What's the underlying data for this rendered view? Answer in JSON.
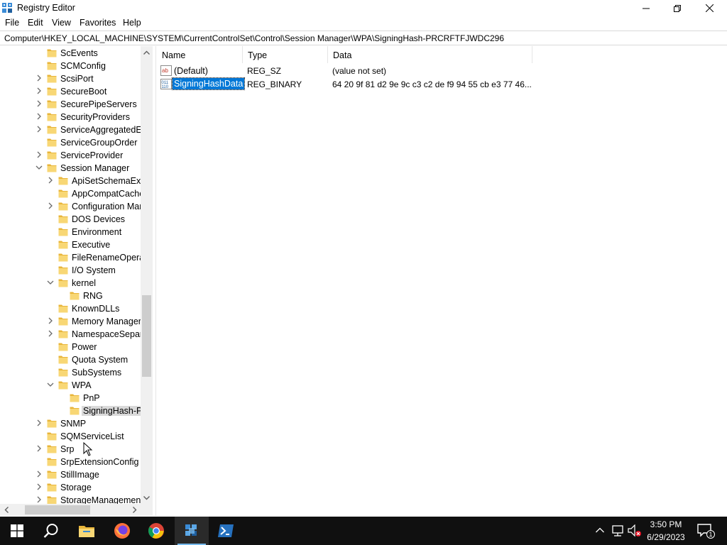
{
  "window": {
    "title": "Registry Editor",
    "controls": {
      "minimize": "minimize",
      "maximize": "restore",
      "close": "close"
    }
  },
  "menu": {
    "items": [
      "File",
      "Edit",
      "View",
      "Favorites",
      "Help"
    ]
  },
  "address": {
    "path": "Computer\\HKEY_LOCAL_MACHINE\\SYSTEM\\CurrentControlSet\\Control\\Session Manager\\WPA\\SigningHash-PRCRFTFJWDC296"
  },
  "tree": {
    "items": [
      {
        "label": "ScEvents",
        "level": 0,
        "expander": "none"
      },
      {
        "label": "SCMConfig",
        "level": 0,
        "expander": "none"
      },
      {
        "label": "ScsiPort",
        "level": 0,
        "expander": "collapsed"
      },
      {
        "label": "SecureBoot",
        "level": 0,
        "expander": "collapsed"
      },
      {
        "label": "SecurePipeServers",
        "level": 0,
        "expander": "collapsed"
      },
      {
        "label": "SecurityProviders",
        "level": 0,
        "expander": "collapsed"
      },
      {
        "label": "ServiceAggregatedEv",
        "level": 0,
        "expander": "collapsed"
      },
      {
        "label": "ServiceGroupOrder",
        "level": 0,
        "expander": "none"
      },
      {
        "label": "ServiceProvider",
        "level": 0,
        "expander": "collapsed"
      },
      {
        "label": "Session Manager",
        "level": 0,
        "expander": "expanded"
      },
      {
        "label": "ApiSetSchemaExte",
        "level": 1,
        "expander": "collapsed"
      },
      {
        "label": "AppCompatCache",
        "level": 1,
        "expander": "none"
      },
      {
        "label": "Configuration Mar",
        "level": 1,
        "expander": "collapsed"
      },
      {
        "label": "DOS Devices",
        "level": 1,
        "expander": "none"
      },
      {
        "label": "Environment",
        "level": 1,
        "expander": "none"
      },
      {
        "label": "Executive",
        "level": 1,
        "expander": "none"
      },
      {
        "label": "FileRenameOperat",
        "level": 1,
        "expander": "none"
      },
      {
        "label": "I/O System",
        "level": 1,
        "expander": "none"
      },
      {
        "label": "kernel",
        "level": 1,
        "expander": "expanded"
      },
      {
        "label": "RNG",
        "level": 2,
        "expander": "none"
      },
      {
        "label": "KnownDLLs",
        "level": 1,
        "expander": "none"
      },
      {
        "label": "Memory Manager",
        "level": 1,
        "expander": "collapsed"
      },
      {
        "label": "NamespaceSepara",
        "level": 1,
        "expander": "collapsed"
      },
      {
        "label": "Power",
        "level": 1,
        "expander": "none"
      },
      {
        "label": "Quota System",
        "level": 1,
        "expander": "none"
      },
      {
        "label": "SubSystems",
        "level": 1,
        "expander": "none"
      },
      {
        "label": "WPA",
        "level": 1,
        "expander": "expanded"
      },
      {
        "label": "PnP",
        "level": 2,
        "expander": "none"
      },
      {
        "label": "SigningHash-P",
        "level": 2,
        "expander": "none",
        "selected": true
      },
      {
        "label": "SNMP",
        "level": 0,
        "expander": "collapsed"
      },
      {
        "label": "SQMServiceList",
        "level": 0,
        "expander": "none"
      },
      {
        "label": "Srp",
        "level": 0,
        "expander": "collapsed"
      },
      {
        "label": "SrpExtensionConfig",
        "level": 0,
        "expander": "none"
      },
      {
        "label": "StillImage",
        "level": 0,
        "expander": "collapsed"
      },
      {
        "label": "Storage",
        "level": 0,
        "expander": "collapsed"
      },
      {
        "label": "StorageManagement",
        "level": 0,
        "expander": "collapsed"
      }
    ]
  },
  "list": {
    "columns": [
      {
        "label": "Name"
      },
      {
        "label": "Type"
      },
      {
        "label": "Data"
      }
    ],
    "rows": [
      {
        "name": "(Default)",
        "type": "REG_SZ",
        "data": "(value not set)",
        "icon": "string-value-icon",
        "selected": false
      },
      {
        "name": "SigningHashData",
        "type": "REG_BINARY",
        "data": "64 20 9f 81 d2 9e 9c c3 c2 de f9 94 55 cb e3 77 46...",
        "icon": "binary-value-icon",
        "selected": true
      }
    ]
  },
  "taskbar": {
    "apps": [
      {
        "name": "start-button",
        "icon": "windows-logo-icon"
      },
      {
        "name": "search-button",
        "icon": "search-icon"
      },
      {
        "name": "file-explorer",
        "icon": "folder-icon"
      },
      {
        "name": "firefox",
        "icon": "firefox-icon"
      },
      {
        "name": "chrome",
        "icon": "chrome-icon"
      },
      {
        "name": "registry-editor",
        "icon": "regedit-icon",
        "active": true
      },
      {
        "name": "powershell",
        "icon": "powershell-icon"
      }
    ],
    "time": "3:50 PM",
    "date": "6/29/2023",
    "notification_count": "1"
  },
  "colors": {
    "selection": "#0078d7",
    "folder": "#f8d775",
    "taskbar": "#101010"
  }
}
